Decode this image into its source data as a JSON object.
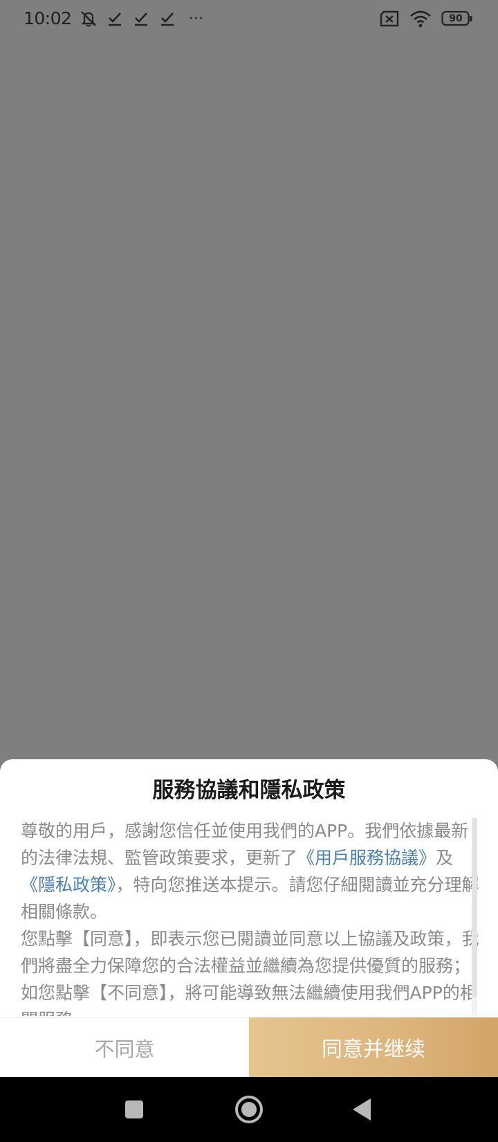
{
  "status_bar": {
    "time": "10:02",
    "icons_left": [
      "notification-muted-icon",
      "check-icon",
      "check-icon",
      "check-icon",
      "more-dots-icon"
    ],
    "more_label": "···",
    "icons_right": [
      "sim-x-icon",
      "wifi-icon",
      "battery-icon"
    ],
    "battery_level": "90"
  },
  "dialog": {
    "title": "服務協議和隱私政策",
    "body": {
      "p1_pre": "尊敬的用戶，感謝您信任並使用我們的APP。我們依據最新的法律法規、監管政策要求，更新了",
      "link_terms": "《用戶服務協議》",
      "p1_mid": "及",
      "link_privacy": "《隱私政策》",
      "p1_post": "，特向您推送本提示。請您仔細閱讀並充分理解相關條款。",
      "p2": "您點擊【同意】，即表示您已閱讀並同意以上協議及政策，我們將盡全力保障您的合法權益並繼續為您提供優質的服務；如您點擊【不同意】，將可能導致無法繼續使用我們APP的相關服務。"
    },
    "disagree_label": "不同意",
    "agree_label": "同意并继续"
  },
  "colors": {
    "overlay": "#7f7f7f",
    "link": "#4a7fb3",
    "agree_gradient_start": "#e6c48f",
    "agree_gradient_end": "#d4a468",
    "disagree_text": "#a8a8a8"
  },
  "nav_bar": {
    "icons": [
      "recents-square-icon",
      "home-circle-icon",
      "back-triangle-icon"
    ]
  }
}
